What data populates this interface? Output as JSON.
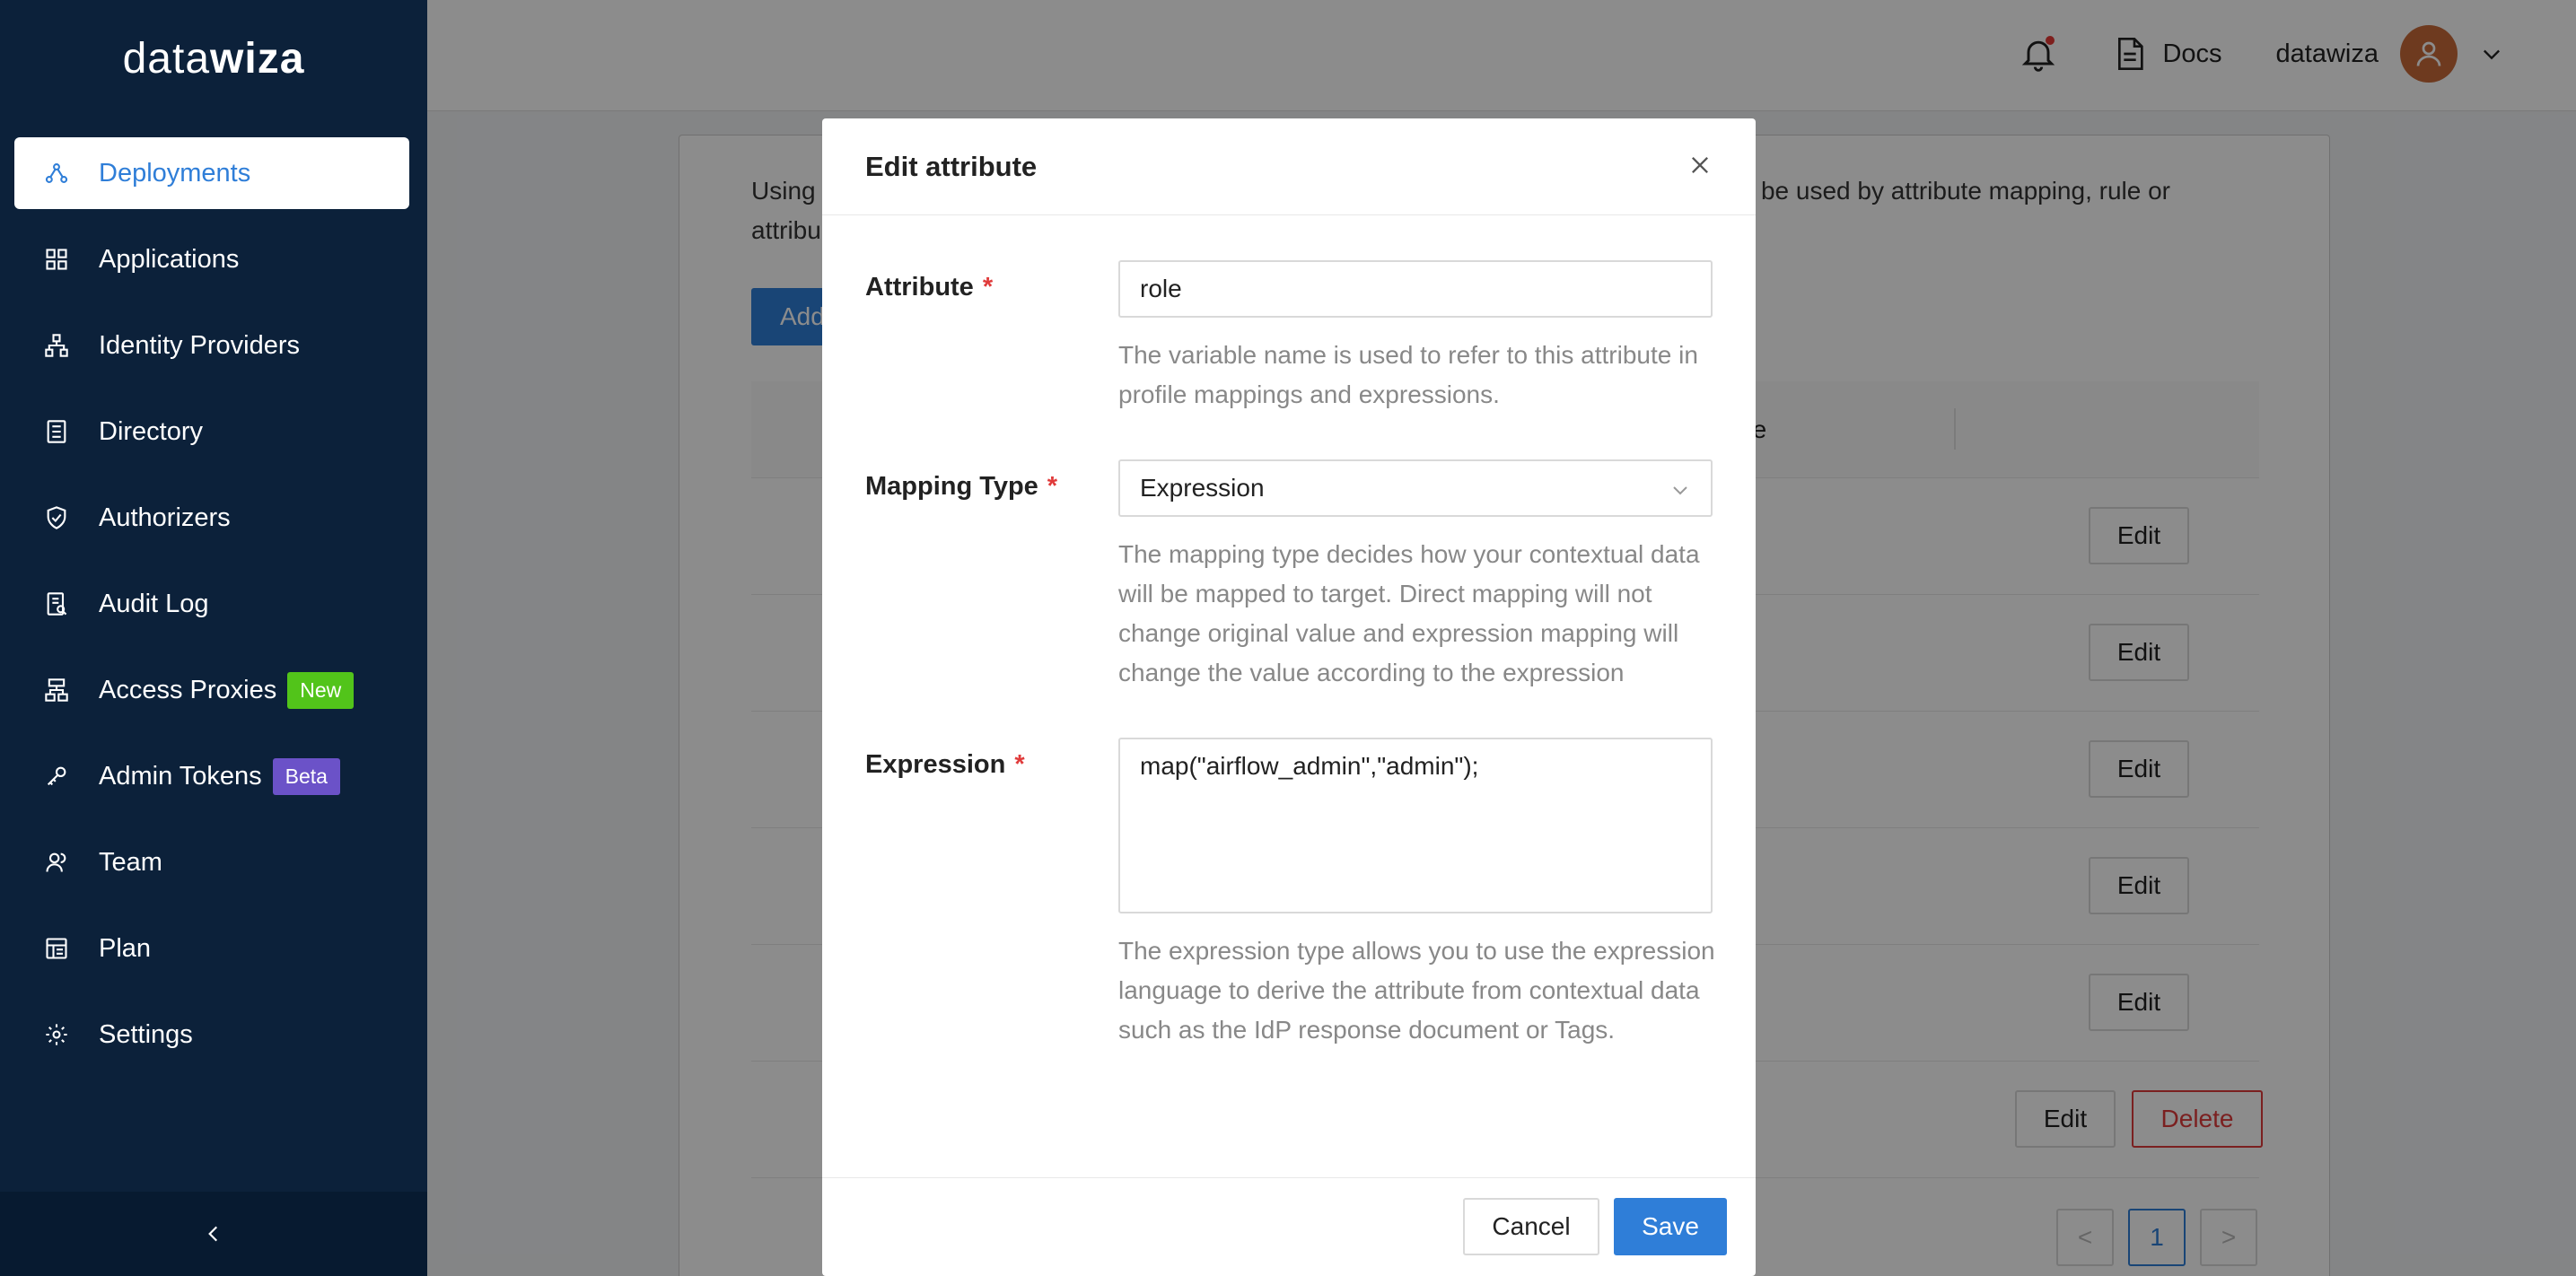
{
  "app": {
    "logo_light": "data",
    "logo_bold": "wiza"
  },
  "sidebar": {
    "items": [
      {
        "label": "Deployments",
        "icon": "deployments-icon"
      },
      {
        "label": "Applications",
        "icon": "grid-icon"
      },
      {
        "label": "Identity Providers",
        "icon": "network-icon"
      },
      {
        "label": "Directory",
        "icon": "directory-icon"
      },
      {
        "label": "Authorizers",
        "icon": "shield-icon"
      },
      {
        "label": "Audit Log",
        "icon": "audit-log-icon"
      },
      {
        "label": "Access Proxies",
        "icon": "proxy-icon",
        "badge": "New"
      },
      {
        "label": "Admin Tokens",
        "icon": "token-icon",
        "badge": "Beta"
      },
      {
        "label": "Team",
        "icon": "team-icon"
      },
      {
        "label": "Plan",
        "icon": "plan-icon"
      },
      {
        "label": "Settings",
        "icon": "gear-icon"
      }
    ],
    "active": "Deployments",
    "collapse_label": "<"
  },
  "header": {
    "docs_label": "Docs",
    "username": "datawiza"
  },
  "background": {
    "intro_left": "Using",
    "intro_left2": "attribu",
    "intro_right": "n be used by attribute mapping, rule or",
    "add_button": "Add",
    "column_partial": "pe",
    "edit_label": "Edit",
    "delete_label": "Delete",
    "page_current": "1",
    "prev_label": "<",
    "next_label": ">"
  },
  "modal": {
    "title": "Edit attribute",
    "attribute": {
      "label": "Attribute",
      "required_mark": "*",
      "value": "role",
      "help": "The variable name is used to refer to this attribute in profile mappings and expressions."
    },
    "mapping_type": {
      "label": "Mapping Type",
      "required_mark": "*",
      "value": "Expression",
      "help": "The mapping type decides how your contextual data will be mapped to target. Direct mapping will not change original value and expression mapping will change the value according to the expression"
    },
    "expression": {
      "label": "Expression",
      "required_mark": "*",
      "value": "map(\"airflow_admin\",\"admin\");",
      "help": "The expression type allows you to use the expression language to derive the attribute from contextual data such as the IdP response document or Tags."
    },
    "cancel_label": "Cancel",
    "save_label": "Save"
  },
  "colors": {
    "sidebar_bg": "#0c213a",
    "accent": "#2f7ed8",
    "danger": "#e03b3b",
    "badge_new": "#52c41a",
    "badge_beta": "#6b52c8"
  }
}
